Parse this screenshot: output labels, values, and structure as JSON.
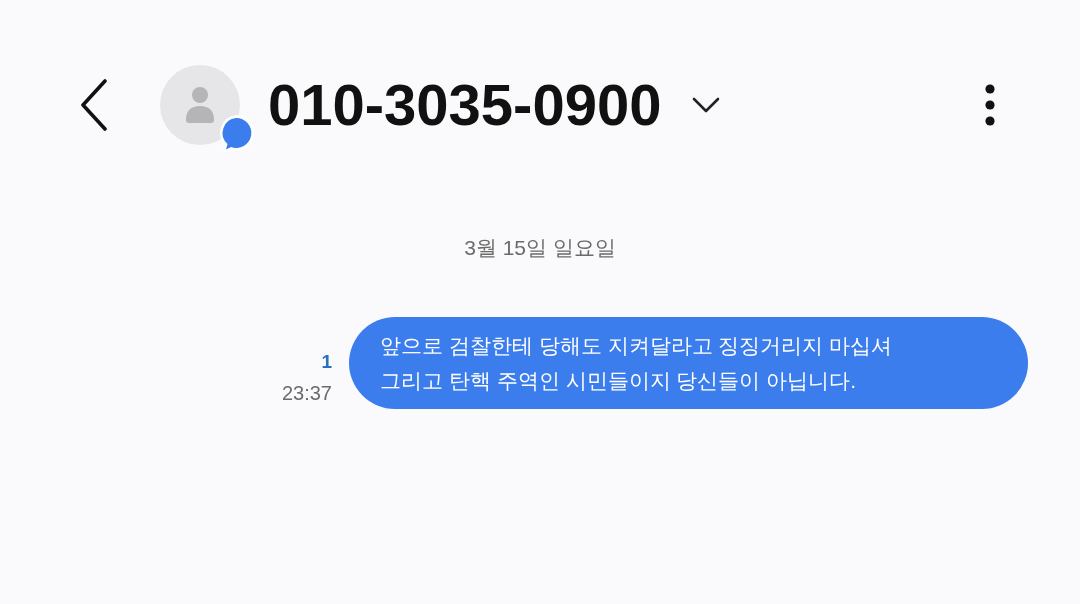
{
  "header": {
    "contact": {
      "name": "010-3035-0900"
    }
  },
  "date_divider": "3월 15일 일요일",
  "messages": [
    {
      "kind": "sent",
      "text": "앞으로 검찰한테 당해도 지켜달라고 징징거리지 마십셔\n그리고 탄핵 주역인 시민들이지 당신들이 아닙니다.",
      "unread_count": "1",
      "time": "23:37"
    }
  ]
}
